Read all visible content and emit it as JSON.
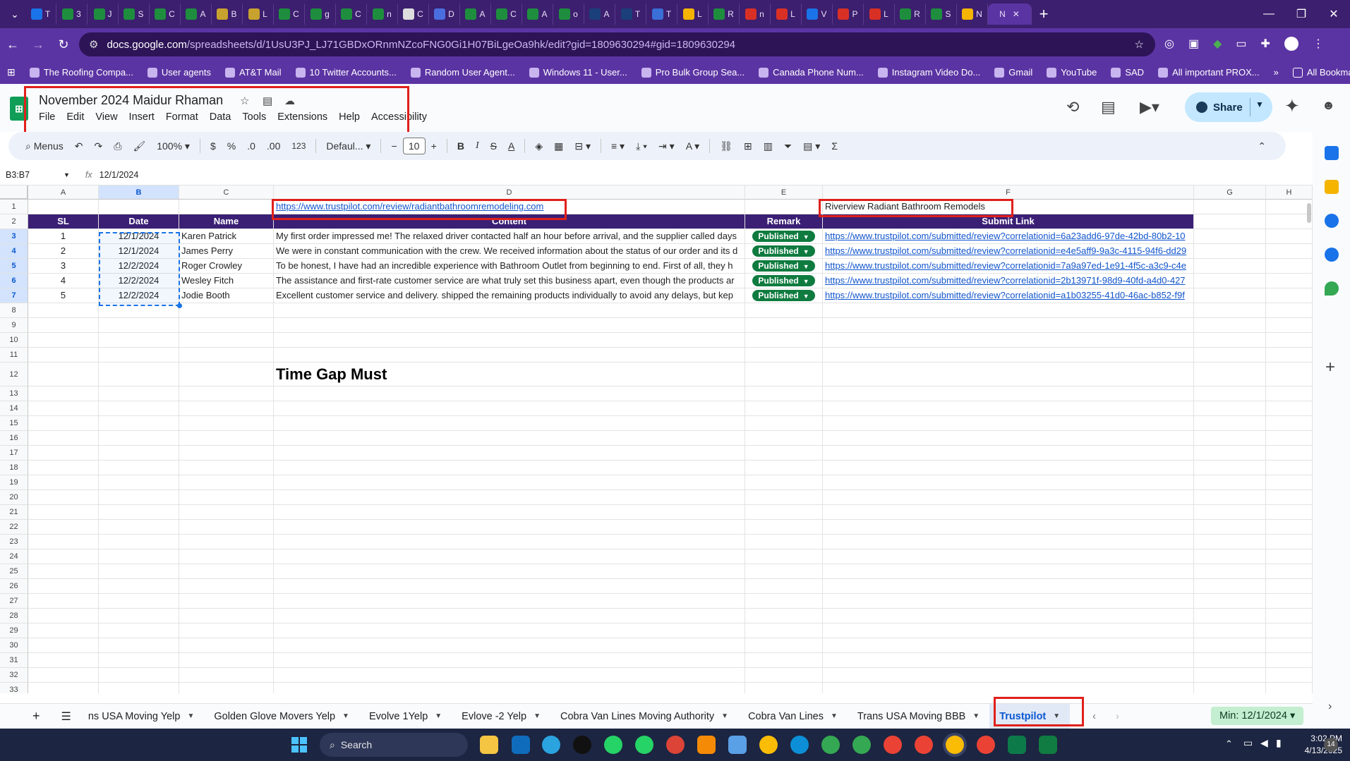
{
  "browser": {
    "tabs": [
      {
        "label": "T",
        "color": "#1a73e8"
      },
      {
        "label": "3",
        "color": "#1e8e3e"
      },
      {
        "label": "J",
        "color": "#1e8e3e"
      },
      {
        "label": "S",
        "color": "#1e8e3e"
      },
      {
        "label": "C",
        "color": "#1e8e3e"
      },
      {
        "label": "A",
        "color": "#1e8e3e"
      },
      {
        "label": "B",
        "color": "#c8a22e"
      },
      {
        "label": "L",
        "color": "#c8a22e"
      },
      {
        "label": "C",
        "color": "#1e8e3e"
      },
      {
        "label": "g",
        "color": "#1e8e3e"
      },
      {
        "label": "C",
        "color": "#1e8e3e"
      },
      {
        "label": "n",
        "color": "#1e8e3e"
      },
      {
        "label": "C",
        "color": "#dddddd"
      },
      {
        "label": "D",
        "color": "#4a6ee0"
      },
      {
        "label": "A",
        "color": "#1e8e3e"
      },
      {
        "label": "C",
        "color": "#1e8e3e"
      },
      {
        "label": "A",
        "color": "#1e8e3e"
      },
      {
        "label": "o",
        "color": "#1e8e3e"
      },
      {
        "label": "A",
        "color": "#1a3f7a"
      },
      {
        "label": "T",
        "color": "#1a3f7a"
      },
      {
        "label": "T",
        "color": "#3b6fd8"
      },
      {
        "label": "L",
        "color": "#f4b400"
      },
      {
        "label": "R",
        "color": "#1e8e3e"
      },
      {
        "label": "n",
        "color": "#d93025"
      },
      {
        "label": "L",
        "color": "#d93025"
      },
      {
        "label": "V",
        "color": "#1a73e8"
      },
      {
        "label": "P",
        "color": "#d93025"
      },
      {
        "label": "L",
        "color": "#d93025"
      },
      {
        "label": "R",
        "color": "#1e8e3e"
      },
      {
        "label": "S",
        "color": "#1e8e3e"
      },
      {
        "label": "N",
        "color": "#f4b400"
      }
    ],
    "active_tab": {
      "label": "N",
      "close": "✕"
    },
    "new_tab": "+",
    "url_host": "docs.google.com",
    "url_path": "/spreadsheets/d/1UsU3PJ_LJ71GBDxORnmNZcoFNG0Gi1H07BiLgeOa9hk/edit?gid=1809630294#gid=1809630294",
    "bookmarks": [
      "The Roofing Compa...",
      "User agents",
      "AT&T Mail",
      "10 Twitter Accounts...",
      "Random User Agent...",
      "Windows 11 - User...",
      "Pro Bulk Group Sea...",
      "Canada Phone Num...",
      "Instagram Video Do...",
      "Gmail",
      "YouTube",
      "SAD",
      "All important PROX..."
    ],
    "bookmarks_overflow": "»",
    "all_bookmarks": "All Bookmarks"
  },
  "sheet": {
    "logo_text": "⊞",
    "title": "November 2024 Maidur Rhaman",
    "menu": [
      "File",
      "Edit",
      "View",
      "Insert",
      "Format",
      "Data",
      "Tools",
      "Extensions",
      "Help",
      "Accessibility"
    ],
    "share_label": "Share",
    "toolbar": {
      "menus": "Menus",
      "zoom": "100%",
      "currency": "$",
      "percent": "%",
      "dec_decrease": ".0",
      "dec_increase": ".00",
      "number_format": "123",
      "font": "Defaul...",
      "font_size": "10",
      "bold": "B",
      "italic": "I",
      "strike": "S",
      "text_color": "A",
      "text_rotate": "A"
    },
    "namebox": "B3:B7",
    "fx": "fx",
    "formula": "12/1/2024",
    "columns": [
      "A",
      "B",
      "C",
      "D",
      "E",
      "F",
      "G",
      "H"
    ],
    "row_numbers": [
      "1",
      "2",
      "3",
      "4",
      "5",
      "6",
      "7",
      "8",
      "9",
      "10",
      "11",
      "12",
      "13",
      "14",
      "15",
      "16",
      "17",
      "18",
      "19",
      "20",
      "21",
      "22",
      "23",
      "24",
      "25",
      "26",
      "27",
      "28",
      "29",
      "30",
      "31",
      "32",
      "33"
    ],
    "row1": {
      "link": "https://www.trustpilot.com/review/radiantbathroomremodeling.com",
      "company": "Riverview Radiant Bathroom Remodels"
    },
    "headers": [
      "SL",
      "Date",
      "Name",
      "Content",
      "Remark",
      "Submit Link"
    ],
    "rows": [
      {
        "sl": "1",
        "date": "12/1/2024",
        "name": "Karen Patrick",
        "content": "My first order impressed me! The relaxed driver contacted half an hour before arrival, and the supplier called days",
        "remark": "Published",
        "link": "https://www.trustpilot.com/submitted/review?correlationid=6a23add6-97de-42bd-80b2-10"
      },
      {
        "sl": "2",
        "date": "12/1/2024",
        "name": "James Perry",
        "content": "We were in constant communication with the crew. We received information about the status of our order and its d",
        "remark": "Published",
        "link": "https://www.trustpilot.com/submitted/review?correlationid=e4e5aff9-9a3c-4115-94f6-dd29"
      },
      {
        "sl": "3",
        "date": "12/2/2024",
        "name": "Roger Crowley",
        "content": "To be honest, I have had an incredible experience with Bathroom Outlet from beginning to end. First of all, they h",
        "remark": "Published",
        "link": "https://www.trustpilot.com/submitted/review?correlationid=7a9a97ed-1e91-4f5c-a3c9-c4e"
      },
      {
        "sl": "4",
        "date": "12/2/2024",
        "name": "Wesley Fitch",
        "content": "The assistance and first-rate customer service are what truly set this business apart, even though the products ar",
        "remark": "Published",
        "link": "https://www.trustpilot.com/submitted/review?correlationid=2b13971f-98d9-40fd-a4d0-427"
      },
      {
        "sl": "5",
        "date": "12/2/2024",
        "name": "Jodie Booth",
        "content": "Excellent customer service and delivery. shipped the remaining products individually to avoid any delays, but kep",
        "remark": "Published",
        "link": "https://www.trustpilot.com/submitted/review?correlationid=a1b03255-41d0-46ac-b852-f9f"
      }
    ],
    "note": "Time Gap Must",
    "sheet_tabs": [
      "ns USA Moving Yelp",
      "Golden Glove Movers Yelp",
      "Evolve 1Yelp",
      "Evlove -2 Yelp",
      "Cobra Van Lines Moving Authority",
      "Cobra Van Lines",
      "Trans USA Moving BBB",
      "Trustpilot"
    ],
    "active_sheet": "Trustpilot",
    "summary": "Min: 12/1/2024"
  },
  "taskbar": {
    "search": "Search",
    "time": "3:02 PM",
    "date": "4/13/2025",
    "notif_count": "14"
  },
  "colors": {
    "header_fill": "#3b1f75",
    "published_chip": "#0f7b3f",
    "highlight_red": "#e0201b",
    "selection": "#1a73e8"
  }
}
